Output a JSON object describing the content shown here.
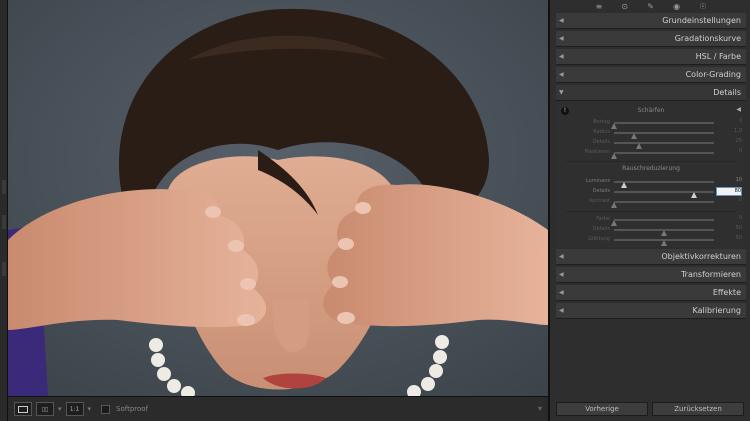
{
  "toolbar": {
    "softproof_label": "Softproof",
    "zoom_label": "1:1",
    "right_label": "▾"
  },
  "tools": [
    "≡",
    "⊙",
    "✎",
    "◉",
    "☉"
  ],
  "sections": {
    "grundeinstellungen": "Grundeinstellungen",
    "gradationskurve": "Gradationskurve",
    "hsl": "HSL / Farbe",
    "color_grading": "Color-Grading",
    "details": "Details",
    "objektivkorrekturen": "Objektivkorrekturen",
    "transformieren": "Transformieren",
    "effekte": "Effekte",
    "kalibrierung": "Kalibrierung"
  },
  "details": {
    "sharpen_heading": "Schärfen",
    "sharpen": [
      {
        "name": "Betrag",
        "value": "0",
        "position": 0.0
      },
      {
        "name": "Radius",
        "value": "1,0",
        "position": 0.2
      },
      {
        "name": "Details",
        "value": "25",
        "position": 0.25
      },
      {
        "name": "Maskieren",
        "value": "0",
        "position": 0.0
      }
    ],
    "noise_heading": "Rauschreduzierung",
    "noise": [
      {
        "name": "Luminanz",
        "value": "10",
        "position": 0.1
      },
      {
        "name": "Details",
        "value": "80",
        "position": 0.8
      },
      {
        "name": "Kontrast",
        "value": "0",
        "position": 0.0
      }
    ],
    "color": [
      {
        "name": "Farbe",
        "value": "0",
        "position": 0.0
      },
      {
        "name": "Details",
        "value": "50",
        "position": 0.5
      },
      {
        "name": "Glättung",
        "value": "50",
        "position": 0.5
      }
    ]
  },
  "buttons": {
    "previous": "Vorherige",
    "reset": "Zurücksetzen"
  },
  "colors": {
    "background": "#4a5158",
    "hair": "#2a1d16",
    "skin": "#d9a38a",
    "shirt": "#3b2a7a"
  }
}
